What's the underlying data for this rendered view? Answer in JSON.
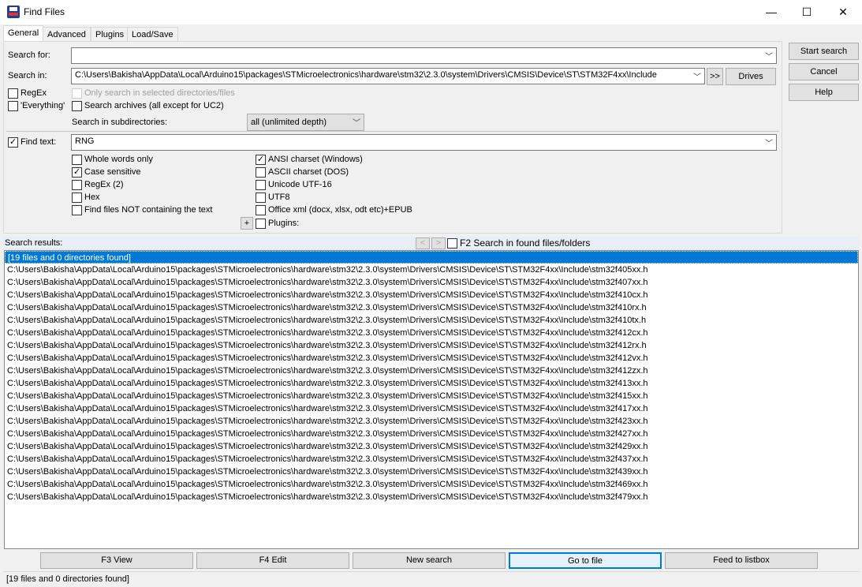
{
  "window": {
    "title": "Find Files",
    "minimize": "—",
    "maximize": "☐",
    "close": "✕"
  },
  "tabs": [
    "General",
    "Advanced",
    "Plugins",
    "Load/Save"
  ],
  "form": {
    "search_for_label": "Search for:",
    "search_for_value": "",
    "search_in_label": "Search in:",
    "search_in_value": "C:\\Users\\Bakisha\\AppData\\Local\\Arduino15\\packages\\STMicroelectronics\\hardware\\stm32\\2.3.0\\system\\Drivers\\CMSIS\\Device\\ST\\STM32F4xx\\Include",
    "more_label": ">>",
    "drives_label": "Drives",
    "regex_label": "RegEx",
    "everything_label": "'Everything'",
    "only_selected_label": "Only search in selected directories/files",
    "archives_label": "Search archives (all except for UC2)",
    "subdirs_label": "Search in subdirectories:",
    "subdirs_value": "all (unlimited depth)",
    "find_text_label": "Find text:",
    "find_text_value": "RNG",
    "find_text_checked": true,
    "options_left": [
      {
        "label": "Whole words only",
        "checked": false
      },
      {
        "label": "Case sensitive",
        "checked": true
      },
      {
        "label": "RegEx (2)",
        "checked": false
      },
      {
        "label": "Hex",
        "checked": false
      },
      {
        "label": "Find files NOT containing the text",
        "checked": false
      }
    ],
    "options_right": [
      {
        "label": "ANSI charset (Windows)",
        "checked": true
      },
      {
        "label": "ASCII charset (DOS)",
        "checked": false
      },
      {
        "label": "Unicode UTF-16",
        "checked": false
      },
      {
        "label": "UTF8",
        "checked": false
      },
      {
        "label": "Office xml (docx, xlsx, odt etc)+EPUB",
        "checked": false
      }
    ],
    "plus_label": "+",
    "plugins_label": "Plugins:"
  },
  "side_buttons": [
    "Start search",
    "Cancel",
    "Help"
  ],
  "results": {
    "label": "Search results:",
    "prev": "<",
    "next": ">",
    "f2_label": "F2 Search in found files/folders",
    "summary": "[19 files and 0 directories found]",
    "prefix": "C:\\Users\\Bakisha\\AppData\\Local\\Arduino15\\packages\\STMicroelectronics\\hardware\\stm32\\2.3.0\\system\\Drivers\\CMSIS\\Device\\ST\\STM32F4xx\\Include\\",
    "files": [
      "stm32f405xx.h",
      "stm32f407xx.h",
      "stm32f410cx.h",
      "stm32f410rx.h",
      "stm32f410tx.h",
      "stm32f412cx.h",
      "stm32f412rx.h",
      "stm32f412vx.h",
      "stm32f412zx.h",
      "stm32f413xx.h",
      "stm32f415xx.h",
      "stm32f417xx.h",
      "stm32f423xx.h",
      "stm32f427xx.h",
      "stm32f429xx.h",
      "stm32f437xx.h",
      "stm32f439xx.h",
      "stm32f469xx.h",
      "stm32f479xx.h"
    ]
  },
  "bottom_buttons": [
    "F3 View",
    "F4 Edit",
    "New search",
    "Go to file",
    "Feed to listbox"
  ],
  "status": "[19 files and 0 directories found]"
}
